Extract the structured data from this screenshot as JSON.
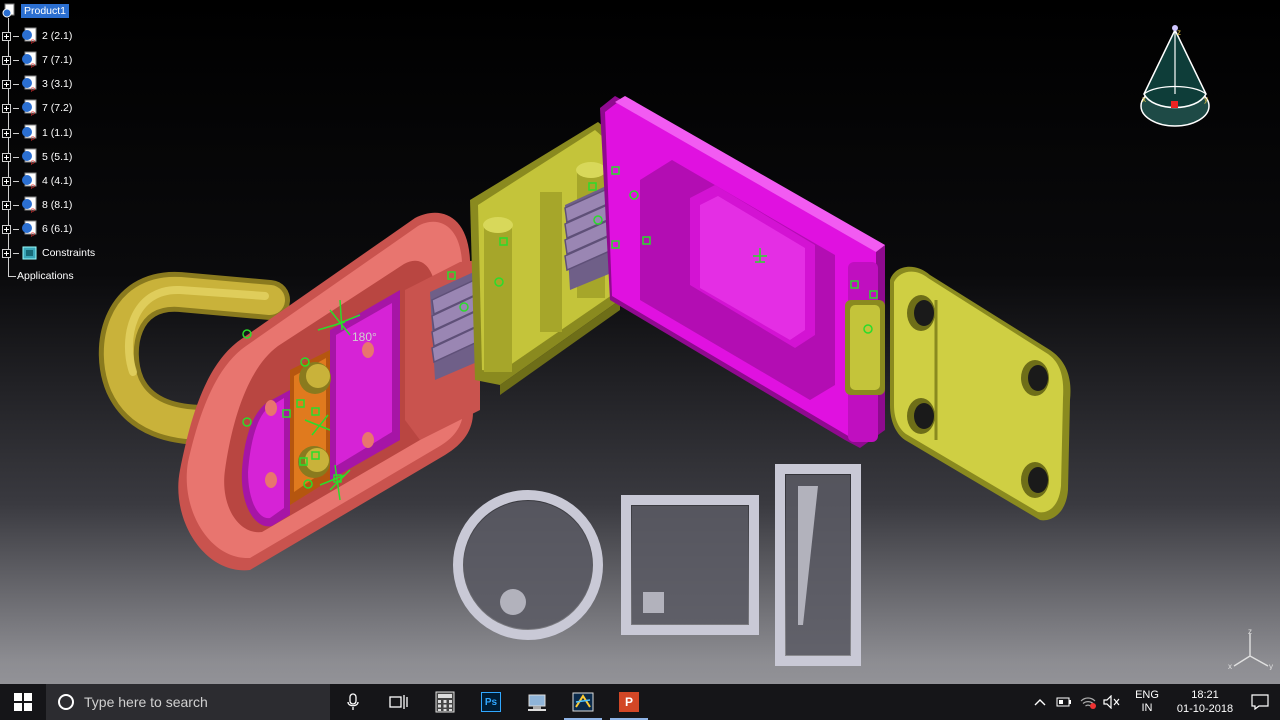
{
  "tree": {
    "root_label": "Product1",
    "items": [
      {
        "label": "2 (2.1)"
      },
      {
        "label": "7 (7.1)"
      },
      {
        "label": "3 (3.1)"
      },
      {
        "label": "7 (7.2)"
      },
      {
        "label": "1 (1.1)"
      },
      {
        "label": "5 (5.1)"
      },
      {
        "label": "4 (4.1)"
      },
      {
        "label": "8 (8.1)"
      },
      {
        "label": "6 (6.1)"
      }
    ],
    "constraints_label": "Constraints",
    "applications_label": "Applications"
  },
  "viewport": {
    "angle_label": "180°"
  },
  "compass": {
    "z_label": "z",
    "x_label": "x",
    "y_label": "y"
  },
  "taskbar": {
    "search_placeholder": "Type here to search",
    "language_line1": "ENG",
    "language_line2": "IN",
    "time": "18:21",
    "date": "01-10-2018",
    "apps": [
      {
        "icon": "calculator-icon"
      },
      {
        "icon": "photoshop-icon",
        "text": "Ps"
      },
      {
        "icon": "network-drive-icon"
      },
      {
        "icon": "catia-icon"
      },
      {
        "icon": "powerpoint-icon",
        "text": "P"
      }
    ]
  },
  "colors": {
    "pink_part": "#e8756f",
    "magenta_part": "#e011e0",
    "olive_part": "#cfcf43",
    "lavender_part": "#9a86b3",
    "brass_part": "#c9b23a",
    "selection": "#2b6fd1"
  }
}
